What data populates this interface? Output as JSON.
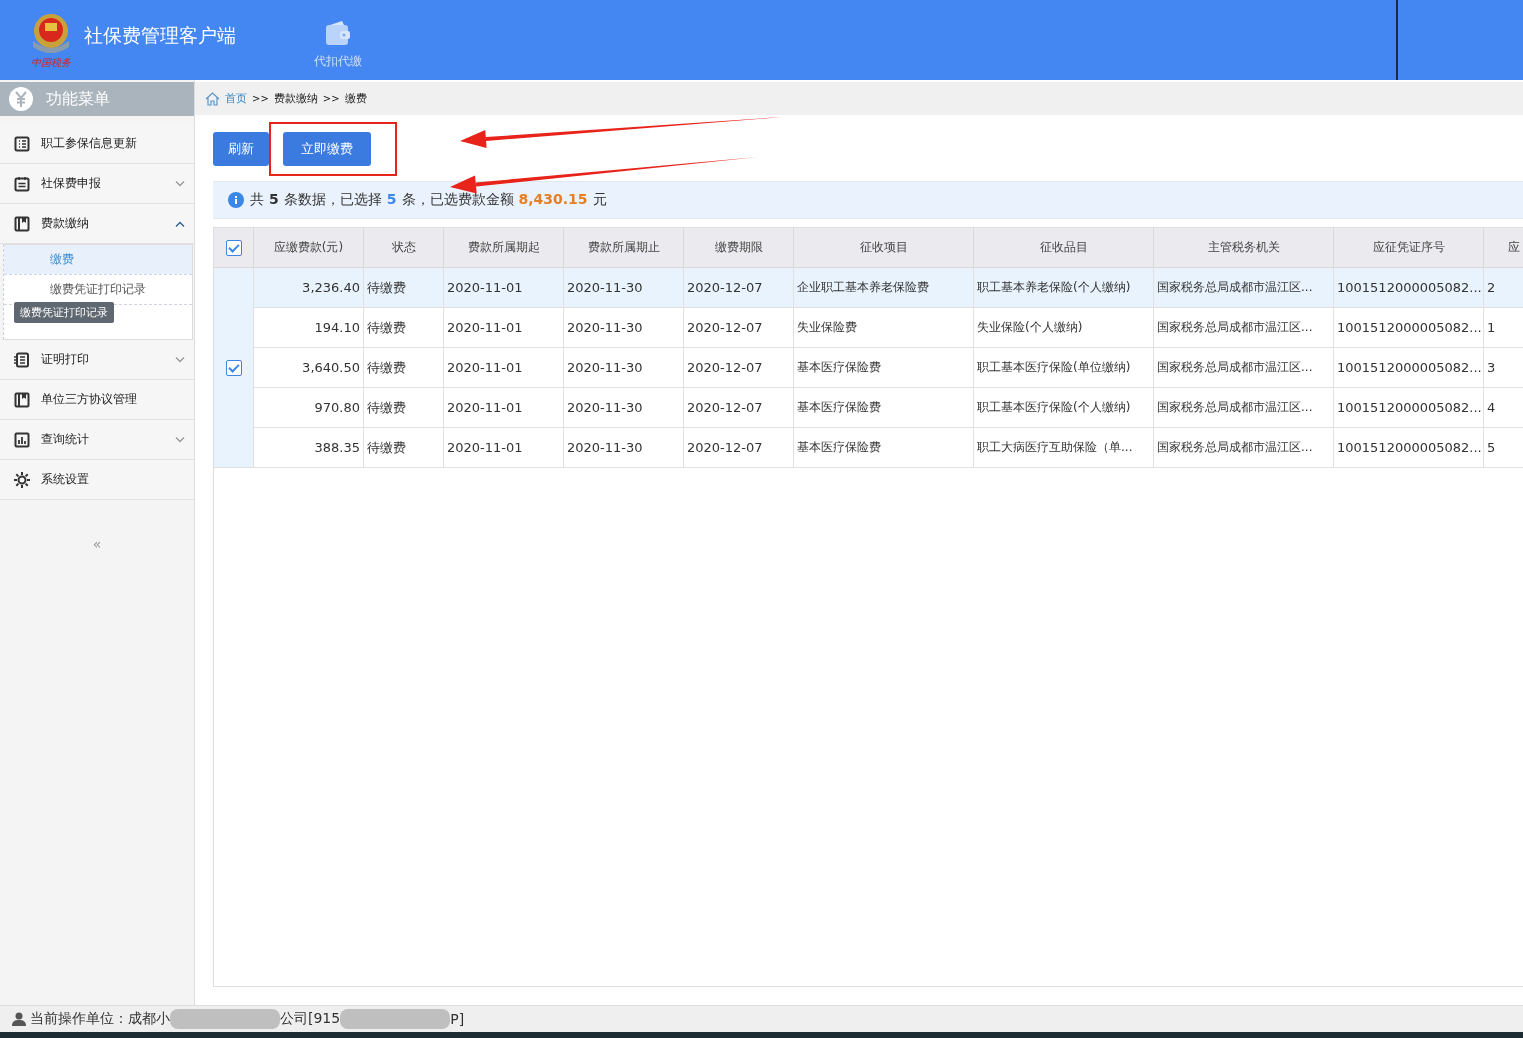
{
  "app": {
    "title": "社保费管理客户端",
    "logo_caption": "中国税务"
  },
  "toolbar": [
    {
      "label": "代扣代缴"
    }
  ],
  "sidebar": {
    "title": "功能菜单",
    "items": [
      {
        "label": "职工参保信息更新",
        "kind": "plain"
      },
      {
        "label": "社保费申报",
        "kind": "group",
        "expanded": false
      },
      {
        "label": "费款缴纳",
        "kind": "group",
        "expanded": true,
        "children": [
          {
            "label": "缴费",
            "selected": true
          },
          {
            "label": "缴费凭证打印记录",
            "selected": false,
            "tooltip": "缴费凭证打印记录"
          }
        ]
      },
      {
        "label": "证明打印",
        "kind": "group",
        "expanded": false
      },
      {
        "label": "单位三方协议管理",
        "kind": "plain"
      },
      {
        "label": "查询统计",
        "kind": "group",
        "expanded": false
      },
      {
        "label": "系统设置",
        "kind": "plain"
      }
    ],
    "collapse": "«"
  },
  "breadcrumb": [
    {
      "label": "首页",
      "link": true
    },
    {
      "label": "费款缴纳",
      "link": false
    },
    {
      "label": "缴费",
      "link": false
    }
  ],
  "breadcrumb_separator": ">>",
  "buttons": [
    {
      "label": "刷新",
      "highlighted": false
    },
    {
      "label": "立即缴费",
      "highlighted": true
    }
  ],
  "summary": {
    "parts": [
      "共",
      "5",
      "条数据，已选择",
      "5",
      "条，已选费款金额",
      "8,430.15",
      "元"
    ]
  },
  "table": {
    "select_all": true,
    "columns": [
      "应缴费款(元)",
      "状态",
      "费款所属期起",
      "费款所属期止",
      "缴费期限",
      "征收项目",
      "征收品目",
      "主管税务机关",
      "应征凭证序号",
      "应"
    ],
    "group_checked": true,
    "rows": [
      {
        "selected": true,
        "cells": [
          "3,236.40",
          "待缴费",
          "2020-11-01",
          "2020-11-30",
          "2020-12-07",
          "企业职工基本养老保险费",
          "职工基本养老保险(个人缴纳)",
          "国家税务总局成都市温江区...",
          "1001512000005082...",
          "2"
        ]
      },
      {
        "selected": false,
        "cells": [
          "194.10",
          "待缴费",
          "2020-11-01",
          "2020-11-30",
          "2020-12-07",
          "失业保险费",
          "失业保险(个人缴纳)",
          "国家税务总局成都市温江区...",
          "1001512000005082...",
          "1"
        ]
      },
      {
        "selected": false,
        "cells": [
          "3,640.50",
          "待缴费",
          "2020-11-01",
          "2020-11-30",
          "2020-12-07",
          "基本医疗保险费",
          "职工基本医疗保险(单位缴纳)",
          "国家税务总局成都市温江区...",
          "1001512000005082...",
          "3"
        ]
      },
      {
        "selected": false,
        "cells": [
          "970.80",
          "待缴费",
          "2020-11-01",
          "2020-11-30",
          "2020-12-07",
          "基本医疗保险费",
          "职工基本医疗保险(个人缴纳)",
          "国家税务总局成都市温江区...",
          "1001512000005082...",
          "4"
        ]
      },
      {
        "selected": false,
        "cells": [
          "388.35",
          "待缴费",
          "2020-11-01",
          "2020-11-30",
          "2020-12-07",
          "基本医疗保险费",
          "职工大病医疗互助保险（单...",
          "国家税务总局成都市温江区...",
          "1001512000005082...",
          "5"
        ]
      }
    ]
  },
  "annotations": [
    {
      "kind": "arrow"
    },
    {
      "kind": "arrow"
    }
  ],
  "status_bar": {
    "parts": [
      {
        "kind": "text",
        "text": "当前操作单位：成都小"
      },
      {
        "kind": "redacted"
      },
      {
        "kind": "text",
        "text": "公司[915"
      },
      {
        "kind": "redacted"
      },
      {
        "kind": "text",
        "text": "P]"
      }
    ]
  }
}
